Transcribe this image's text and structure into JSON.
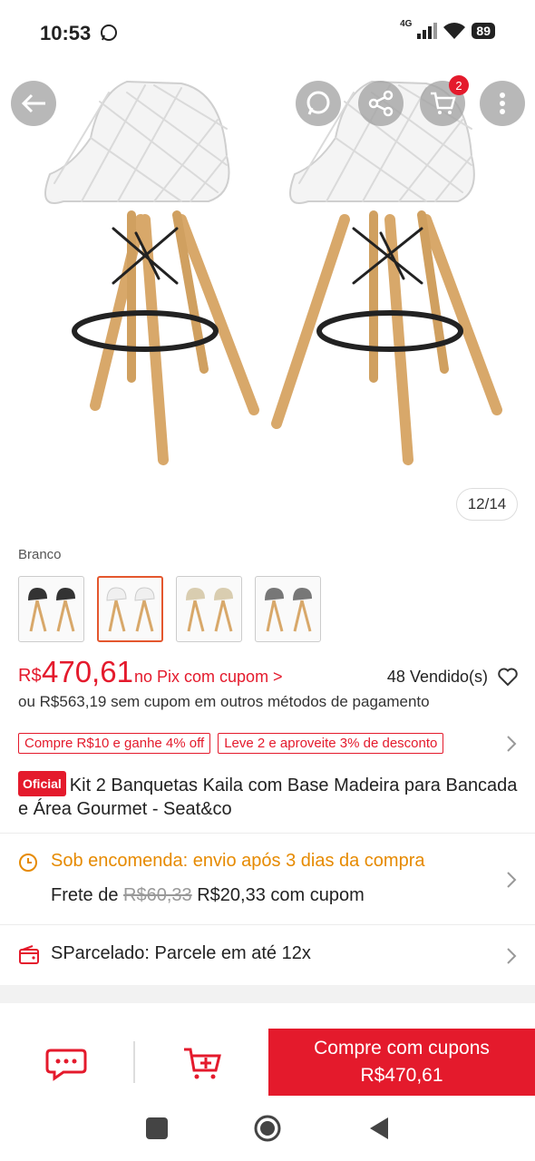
{
  "status_bar": {
    "time": "10:53",
    "network": "4G",
    "battery": "89"
  },
  "hero": {
    "image_counter": "12/14",
    "cart_count": "2"
  },
  "variant": {
    "label": "Branco",
    "selected_index": 1
  },
  "price": {
    "currency": "R$",
    "value": "470,61",
    "pix_text": "no Pix com cupom >",
    "sold": "48 Vendido(s)",
    "alt_text": "ou R$563,19 sem cupom em outros métodos de pagamento"
  },
  "promos": [
    "Compre R$10 e ganhe 4% off",
    "Leve 2 e aproveite 3% de desconto"
  ],
  "product": {
    "badge": "Oficial",
    "title": "Kit 2 Banquetas Kaila com Base Madeira para Bancada e Área Gourmet - Seat&co"
  },
  "shipping": {
    "status": "Sob encomenda: envio após 3 dias da compra",
    "fee_prefix": "Frete de",
    "old_price": "R$60,33",
    "new_price": "R$20,33 com cupom"
  },
  "installments": {
    "label": "SParcelado: Parcele em até 12x"
  },
  "action_bar": {
    "buy_label": "Compre com cupons",
    "buy_price": "R$470,61"
  },
  "colors": {
    "accent": "#e41a2c",
    "orange": "#e68a00"
  }
}
